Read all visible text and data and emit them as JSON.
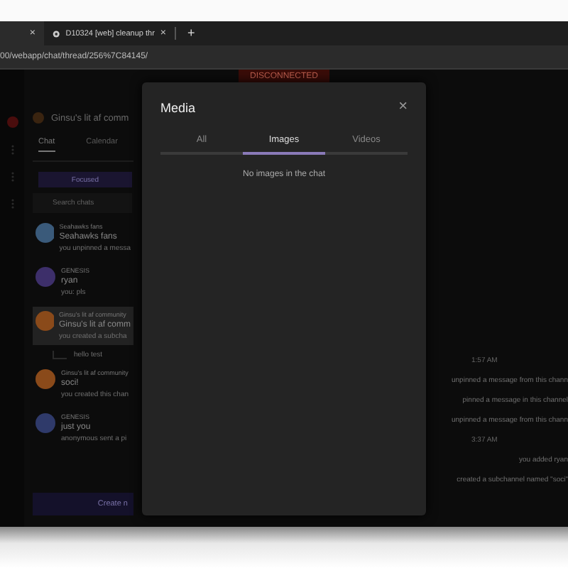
{
  "browser": {
    "tabs": [
      {
        "selected": true,
        "close": "×"
      },
      {
        "title": "D10324 [web] cleanup thr",
        "selected": false,
        "close": "×"
      }
    ],
    "new_tab": "+",
    "url": "00/webapp/chat/thread/256%7C84145/"
  },
  "banner": "DISCONNECTED",
  "sidebar": {
    "header": "Ginsu's lit af comm",
    "tabs": [
      {
        "label": "Chat",
        "selected": true
      },
      {
        "label": "Calendar",
        "selected": false
      }
    ],
    "focused_button": "Focused",
    "search": {
      "placeholder": "Search chats"
    },
    "chats": [
      {
        "group": "Seahawks fans",
        "name": "Seahawks fans",
        "preview": "you unpinned a messa",
        "selected": false,
        "color": "#3a5a7a"
      },
      {
        "group": "GENESIS",
        "name": "ryan",
        "preview": "you: pls",
        "selected": false,
        "color": "#3d2f6a"
      },
      {
        "group": "Ginsu's lit af community",
        "name": "Ginsu's lit af comm",
        "preview": "you created a subcha",
        "selected": true,
        "color": "#8a4a1a",
        "children": [
          {
            "name": "hello test"
          }
        ]
      },
      {
        "group": "Ginsu's lit af community",
        "name": "soci!",
        "preview": "you created this chan",
        "selected": false,
        "color": "#8a4a1a"
      },
      {
        "group": "GENESIS",
        "name": "just you",
        "preview": "anonymous sent a pi",
        "selected": false,
        "color": "#2f3a6a"
      }
    ],
    "create_button": "Create n"
  },
  "messages": [
    {
      "kind": "time",
      "text": "1:57 AM"
    },
    {
      "kind": "event",
      "text": "unpinned a message from this chann"
    },
    {
      "kind": "event",
      "text": "pinned a message in this channel"
    },
    {
      "kind": "event",
      "text": "unpinned a message from this chann"
    },
    {
      "kind": "time",
      "text": "3:37 AM"
    },
    {
      "kind": "event",
      "text": "you added ryan"
    },
    {
      "kind": "event",
      "text": "created a subchannel named \"soci\""
    }
  ],
  "modal": {
    "title": "Media",
    "close": "×",
    "tabs": [
      {
        "label": "All",
        "selected": false
      },
      {
        "label": "Images",
        "selected": true
      },
      {
        "label": "Videos",
        "selected": false
      }
    ],
    "empty": "No images in the chat"
  }
}
